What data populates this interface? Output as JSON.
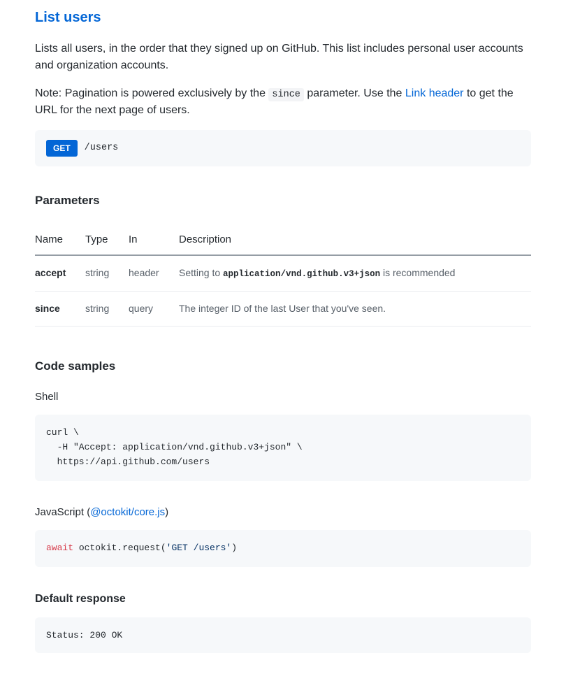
{
  "title": "List users",
  "description": "Lists all users, in the order that they signed up on GitHub. This list includes personal user accounts and organization accounts.",
  "note_prefix": "Note: Pagination is powered exclusively by the ",
  "note_param_code": "since",
  "note_mid": " parameter. Use the ",
  "note_link_text": "Link header",
  "note_suffix": " to get the URL for the next page of users.",
  "endpoint": {
    "method": "GET",
    "path": "/users"
  },
  "parameters_heading": "Parameters",
  "param_headers": {
    "name": "Name",
    "type": "Type",
    "in": "In",
    "description": "Description"
  },
  "parameters": [
    {
      "name": "accept",
      "type": "string",
      "in": "header",
      "desc_prefix": "Setting to ",
      "desc_code": "application/vnd.github.v3+json",
      "desc_suffix": " is recommended"
    },
    {
      "name": "since",
      "type": "string",
      "in": "query",
      "desc_prefix": "The integer ID of the last User that you've seen.",
      "desc_code": "",
      "desc_suffix": ""
    }
  ],
  "code_samples_heading": "Code samples",
  "shell_heading": "Shell",
  "shell_code": "curl \\\n  -H \"Accept: application/vnd.github.v3+json\" \\\n  https://api.github.com/users",
  "js_heading_prefix": "JavaScript (",
  "js_link_text": "@octokit/core.js",
  "js_heading_suffix": ")",
  "js_code_kw": "await",
  "js_code_mid": " octokit.request(",
  "js_code_str": "'GET /users'",
  "js_code_end": ")",
  "response_heading": "Default response",
  "status_text": "Status: 200 OK"
}
